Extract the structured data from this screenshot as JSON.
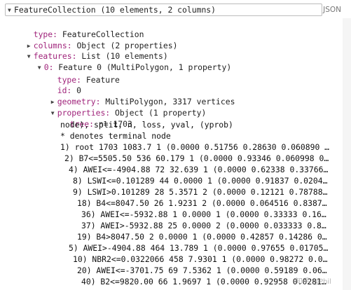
{
  "header": {
    "title": "FeatureCollection (10 elements, 2 columns)",
    "json_label": "JSON"
  },
  "tree": {
    "type_key": "type:",
    "type_val": "FeatureCollection",
    "columns_key": "columns:",
    "columns_val": "Object (2 properties)",
    "features_key": "features:",
    "features_val": "List (10 elements)",
    "f0_key": "0:",
    "f0_val": "Feature 0 (MultiPolygon, 1 property)",
    "f0_type_key": "type:",
    "f0_type_val": "Feature",
    "f0_id_key": "id:",
    "f0_id_val": "0",
    "geometry_key": "geometry:",
    "geometry_val": "MultiPolygon, 3317 vertices",
    "properties_key": "properties:",
    "properties_val": "Object (1 property)",
    "tree_key": "tree:",
    "tree_val": "n= 1703"
  },
  "tree_lines": [
    "node), split, n, loss, yval, (yprob)",
    "* denotes terminal node",
    "1) root 1703 1083.7 1 (0.0000 0.51756 0.28630 0.060890 …",
    "2) B7<=5505.50 536 60.179 1 (0.0000 0.93346 0.060998 0…",
    "4) AWEI<=-4904.88 72 32.639 1 (0.0000 0.62338 0.33766…",
    "8) LSWI<=0.101289 44 0.0000 1 (0.0000 0.91837 0.0204…",
    "9) LSWI>0.101289 28 5.3571 2 (0.0000 0.12121 0.78788…",
    "18) B4<=8047.50 26 1.9231 2 (0.0000 0.064516 0.8387…",
    "36) AWEI<=-5932.88 1 0.0000 1 (0.0000 0.33333 0.16…",
    "37) AWEI>-5932.88 25 0.0000 2 (0.0000 0.033333 0.8…",
    "19) B4>8047.50 2 0.0000 1 (0.0000 0.42857 0.14286 0…",
    "5) AWEI>-4904.88 464 13.789 1 (0.0000 0.97655 0.01705…",
    "10) NBR2<=0.0322066 458 7.9301 1 (0.0000 0.98272 0.0…",
    "20) AWEI<=-3701.75 69 7.5362 1 (0.0000 0.59189 0.06…",
    "40) B2<=9820.00 66 1.9697 1 (0.0000 0.92958 0.0281…"
  ],
  "watermark": "知乎 @Phil"
}
